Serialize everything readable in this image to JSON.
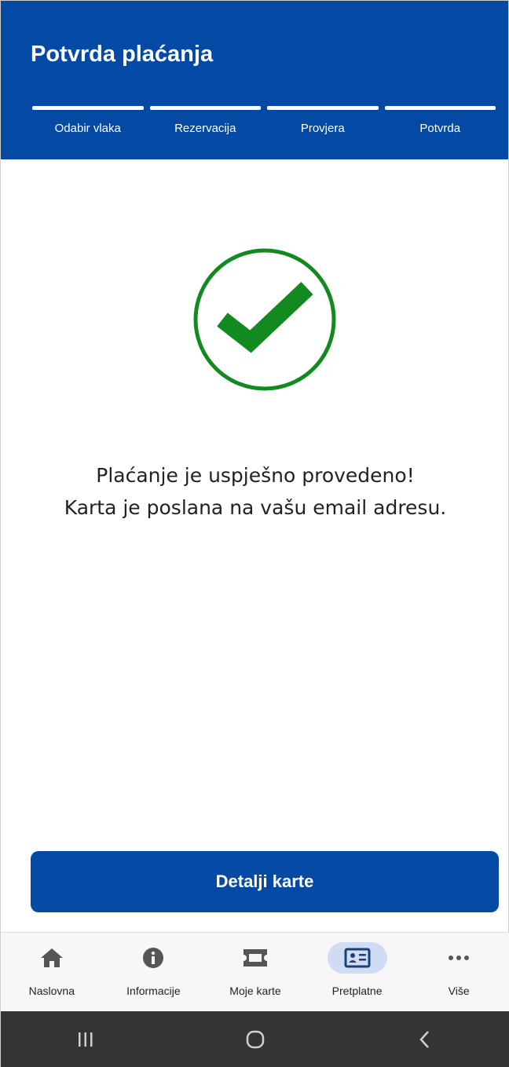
{
  "header": {
    "title": "Potvrda plaćanja",
    "steps": [
      {
        "label": "Odabir vlaka"
      },
      {
        "label": "Rezervacija"
      },
      {
        "label": "Provjera"
      },
      {
        "label": "Potvrda"
      }
    ]
  },
  "status": {
    "icon": "success-check-icon",
    "line1": "Plaćanje je uspješno provedeno!",
    "line2": "Karta je poslana na vašu email adresu."
  },
  "actions": {
    "details_label": "Detalji karte"
  },
  "bottom_nav": {
    "items": [
      {
        "label": "Naslovna",
        "icon": "home-icon"
      },
      {
        "label": "Informacije",
        "icon": "info-icon"
      },
      {
        "label": "Moje karte",
        "icon": "ticket-icon"
      },
      {
        "label": "Pretplatne",
        "icon": "id-card-icon",
        "active": true
      },
      {
        "label": "Više",
        "icon": "more-dots-icon"
      }
    ]
  },
  "colors": {
    "brand": "#044aa5",
    "success": "#138a1f",
    "active_nav_bg": "#cfdcf3"
  }
}
